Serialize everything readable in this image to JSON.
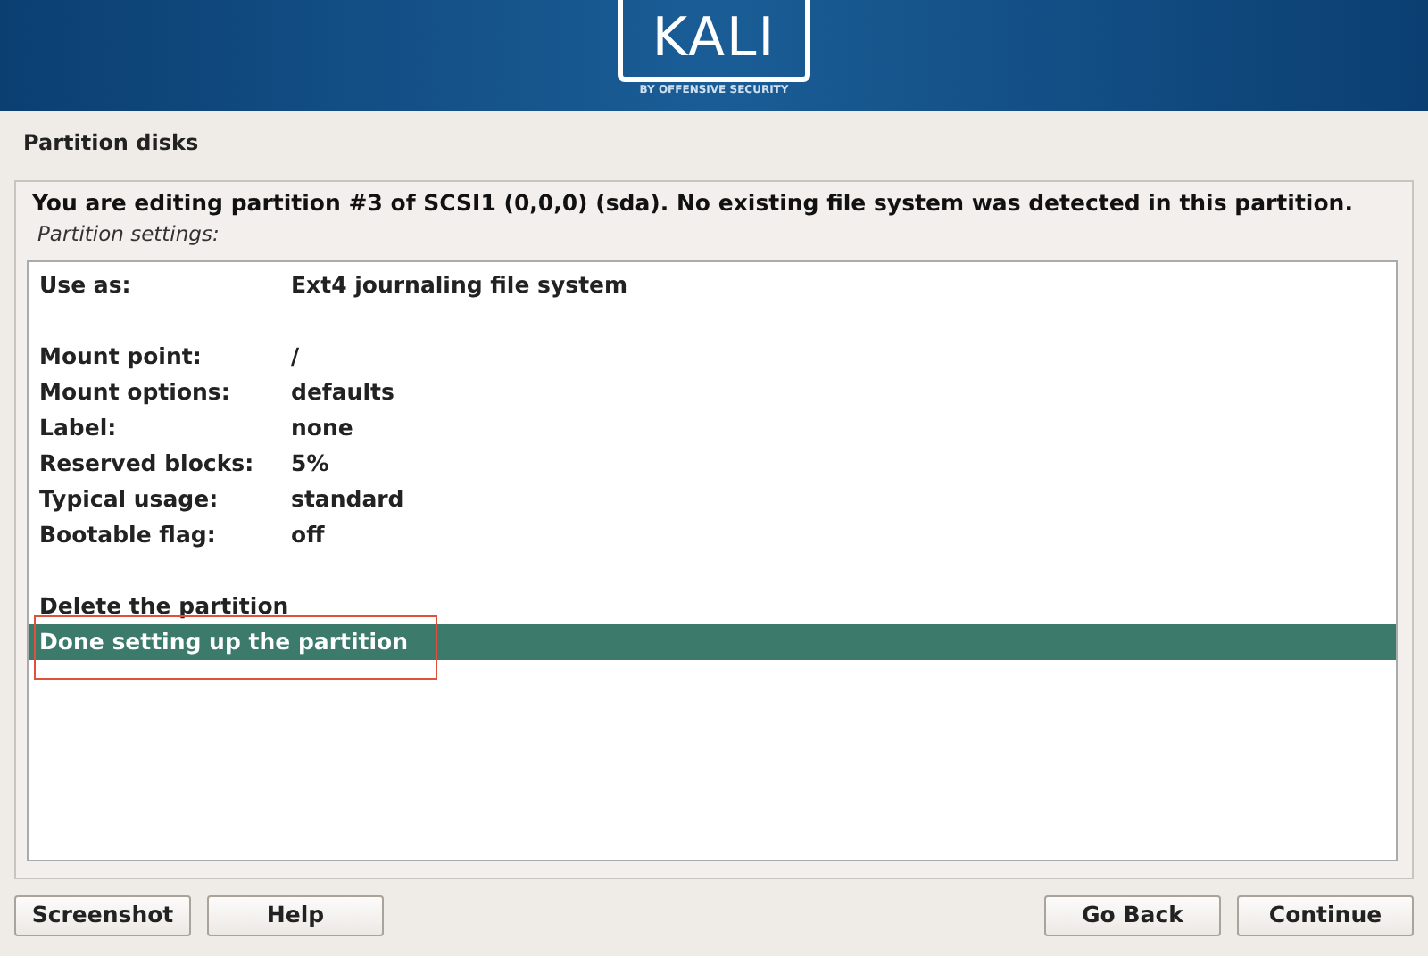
{
  "header": {
    "logo": "KALI",
    "tagline": "BY OFFENSIVE SECURITY"
  },
  "title": "Partition disks",
  "description": "You are editing partition #3 of SCSI1 (0,0,0) (sda). No existing file system was detected in this partition.",
  "list_caption": "Partition settings:",
  "groups": [
    [
      {
        "kind": "setting",
        "label": "Use as:",
        "value": "Ext4 journaling file system",
        "selected": false
      }
    ],
    [
      {
        "kind": "setting",
        "label": "Mount point:",
        "value": "/",
        "selected": false
      },
      {
        "kind": "setting",
        "label": "Mount options:",
        "value": "defaults",
        "selected": false
      },
      {
        "kind": "setting",
        "label": "Label:",
        "value": "none",
        "selected": false
      },
      {
        "kind": "setting",
        "label": "Reserved blocks:",
        "value": "5%",
        "selected": false
      },
      {
        "kind": "setting",
        "label": "Typical usage:",
        "value": "standard",
        "selected": false
      },
      {
        "kind": "setting",
        "label": "Bootable flag:",
        "value": "off",
        "selected": false
      }
    ],
    [
      {
        "kind": "action",
        "label": "Delete the partition",
        "selected": false
      },
      {
        "kind": "action",
        "label": "Done setting up the partition",
        "selected": true
      }
    ]
  ],
  "buttons_left": [
    "Screenshot",
    "Help"
  ],
  "buttons_right": [
    "Go Back",
    "Continue"
  ]
}
